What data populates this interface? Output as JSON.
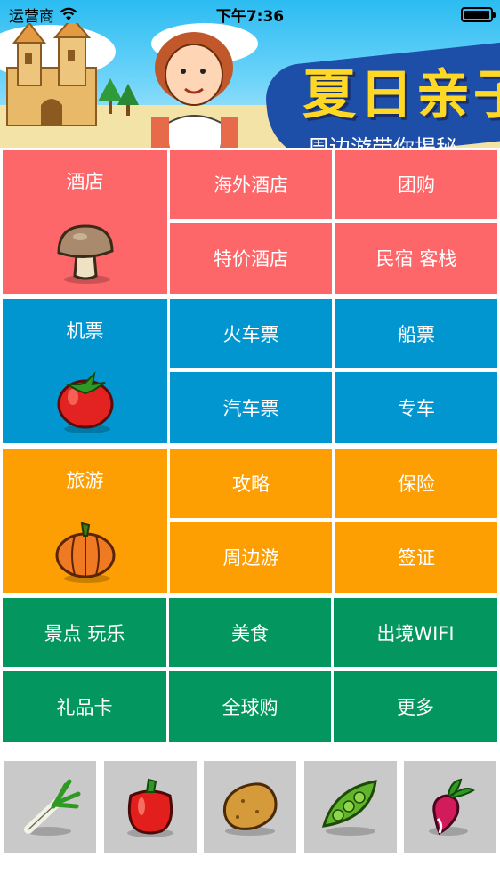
{
  "status_bar": {
    "carrier": "运营商",
    "time": "下午7:36",
    "wifi_icon": "wifi-icon",
    "battery_icon": "battery-icon"
  },
  "banner": {
    "title": "夏日亲子",
    "subtitle": "周边游带你揭秘"
  },
  "sections": {
    "hotel": {
      "color": "#fe6769",
      "main": {
        "label": "酒店",
        "icon": "mushroom-icon"
      },
      "items": [
        "海外酒店",
        "团购",
        "特价酒店",
        "民宿 客栈"
      ]
    },
    "transport": {
      "color": "#0196cf",
      "main": {
        "label": "机票",
        "icon": "tomato-icon"
      },
      "items": [
        "火车票",
        "船票",
        "汽车票",
        "专车"
      ]
    },
    "travel": {
      "color": "#fd9f03",
      "main": {
        "label": "旅游",
        "icon": "pumpkin-icon"
      },
      "items": [
        "攻略",
        "保险",
        "周边游",
        "签证"
      ]
    },
    "more": {
      "color": "#03965e",
      "items": [
        "景点 玩乐",
        "美食",
        "出境WIFI",
        "礼品卡",
        "全球购",
        "更多"
      ]
    }
  },
  "bottom_icons": [
    "scallion-icon",
    "bell-pepper-icon",
    "potato-icon",
    "pea-pod-icon",
    "radish-icon"
  ]
}
